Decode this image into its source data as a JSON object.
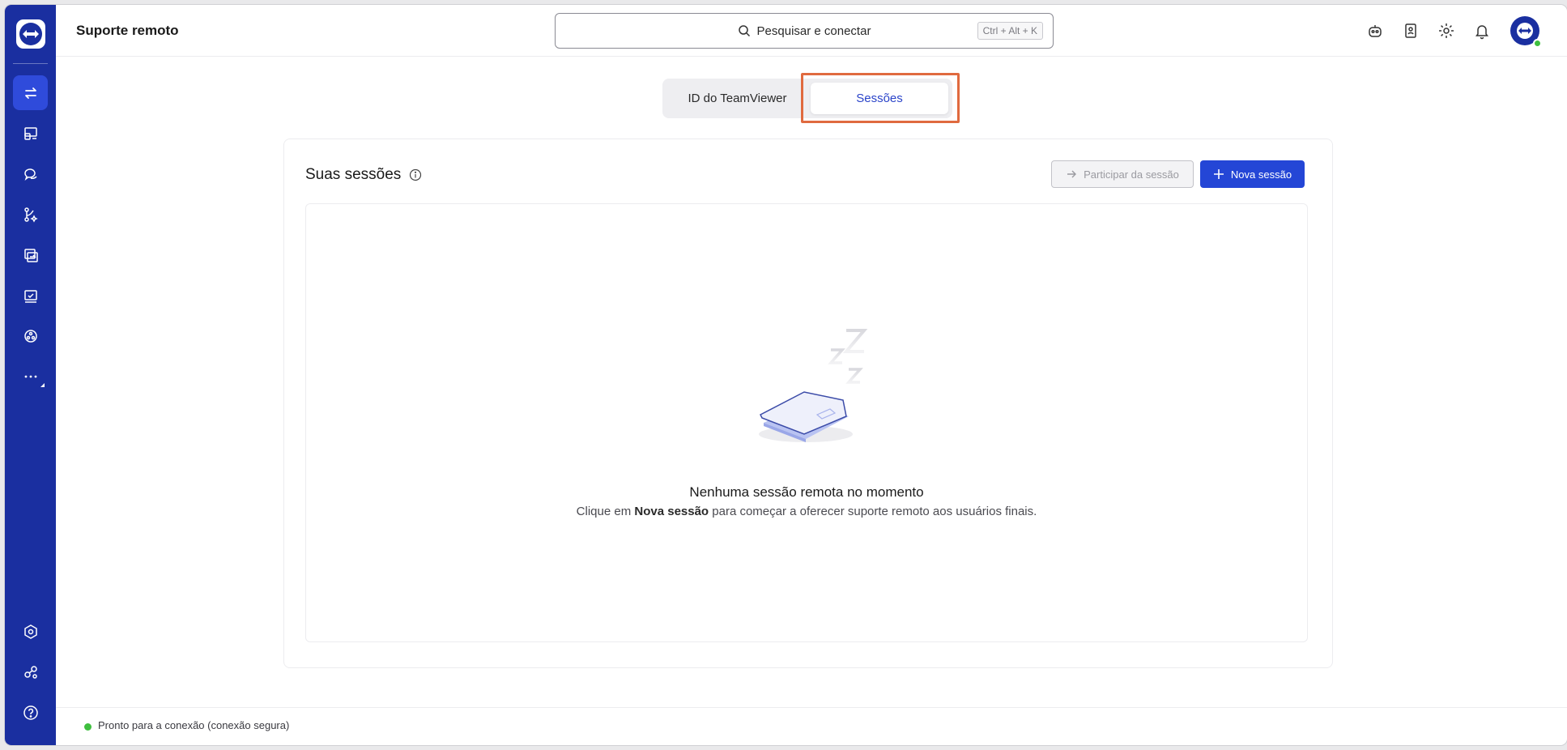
{
  "app": {
    "title": "Suporte remoto"
  },
  "search": {
    "placeholder": "Pesquisar e conectar",
    "shortcut": "Ctrl + Alt + K"
  },
  "sidebar": {
    "items": [
      {
        "name": "remote-connect-icon",
        "active": true
      },
      {
        "name": "devices-icon"
      },
      {
        "name": "chat-icon"
      },
      {
        "name": "flows-icon"
      },
      {
        "name": "transfer-icon"
      },
      {
        "name": "tasks-icon"
      },
      {
        "name": "network-icon"
      },
      {
        "name": "more-icon"
      }
    ],
    "bottom": [
      {
        "name": "admin-settings-icon"
      },
      {
        "name": "integrations-icon"
      },
      {
        "name": "help-icon"
      }
    ]
  },
  "header_icons": [
    "assistant-robot-icon",
    "contacts-icon",
    "settings-gear-icon",
    "notifications-bell-icon"
  ],
  "tabs": [
    {
      "label": "ID do TeamViewer",
      "active": false
    },
    {
      "label": "Sessões",
      "active": true
    }
  ],
  "sessions": {
    "title": "Suas sessões",
    "join_button": "Participar da sessão",
    "new_button": "Nova sessão",
    "empty_title": "Nenhuma sessão remota no momento",
    "empty_sub_prefix": "Clique em ",
    "empty_sub_bold": "Nova sessão",
    "empty_sub_suffix": " para começar a oferecer suporte remoto aos usuários finais."
  },
  "status": {
    "text": "Pronto para a conexão (conexão segura)",
    "color": "#3fbf3f"
  },
  "colors": {
    "sidebar": "#1a2fa0",
    "accent": "#2446d6",
    "highlight": "#e06a3f"
  }
}
